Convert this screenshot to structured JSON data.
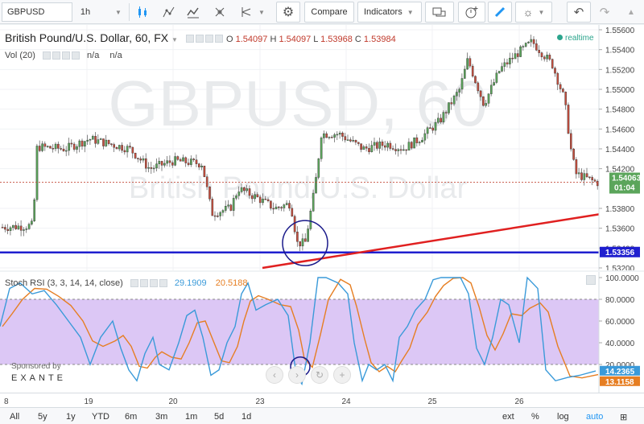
{
  "toolbar": {
    "symbol": "GBPUSD",
    "interval": "1h",
    "compare_label": "Compare",
    "indicators_label": "Indicators"
  },
  "legend": {
    "title": "British Pound/U.S. Dollar, 60, FX",
    "o_label": "O",
    "o_value": "1.54097",
    "h_label": "H",
    "h_value": "1.54097",
    "l_label": "L",
    "l_value": "1.53968",
    "c_label": "C",
    "c_value": "1.53984",
    "vol_label": "Vol (20)",
    "vol_v1": "n/a",
    "vol_v2": "n/a",
    "realtime": "realtime"
  },
  "watermark": {
    "symbol": "GBPUSD, 60",
    "name": "British Pound/U.S. Dollar"
  },
  "price_axis": {
    "ticks": [
      "1.55600",
      "1.55400",
      "1.55200",
      "1.55000",
      "1.54800",
      "1.54600",
      "1.54400",
      "1.54200",
      "1.53800",
      "1.53600",
      "1.53400",
      "1.53200"
    ],
    "last_price": "1.54063",
    "countdown": "01:04",
    "hline_price": "1.53356"
  },
  "rsi": {
    "title": "Stoch RSI (3, 3, 14, 14, close)",
    "k_value": "29.1909",
    "d_value": "20.5188",
    "ticks": [
      "100.0000",
      "80.0000",
      "60.0000",
      "40.0000",
      "20.0000"
    ],
    "k_last": "14.2365",
    "d_last": "13.1158",
    "sponsor": "Sponsored by",
    "brand": "EXANTE"
  },
  "xaxis": {
    "labels": [
      "8",
      "19",
      "20",
      "23",
      "24",
      "25",
      "26"
    ]
  },
  "bottom": {
    "ranges": [
      "All",
      "5y",
      "1y",
      "YTD",
      "6m",
      "3m",
      "1m",
      "5d",
      "1d"
    ],
    "ext": "ext",
    "pct": "%",
    "log": "log",
    "auto": "auto"
  },
  "colors": {
    "up": "#5ba55b",
    "down": "#c44d3d",
    "k_line": "#3a9ad9",
    "d_line": "#e67e22",
    "hline": "#1f1fcf",
    "trend": "#e02020",
    "band": "#dcc7f5"
  }
}
